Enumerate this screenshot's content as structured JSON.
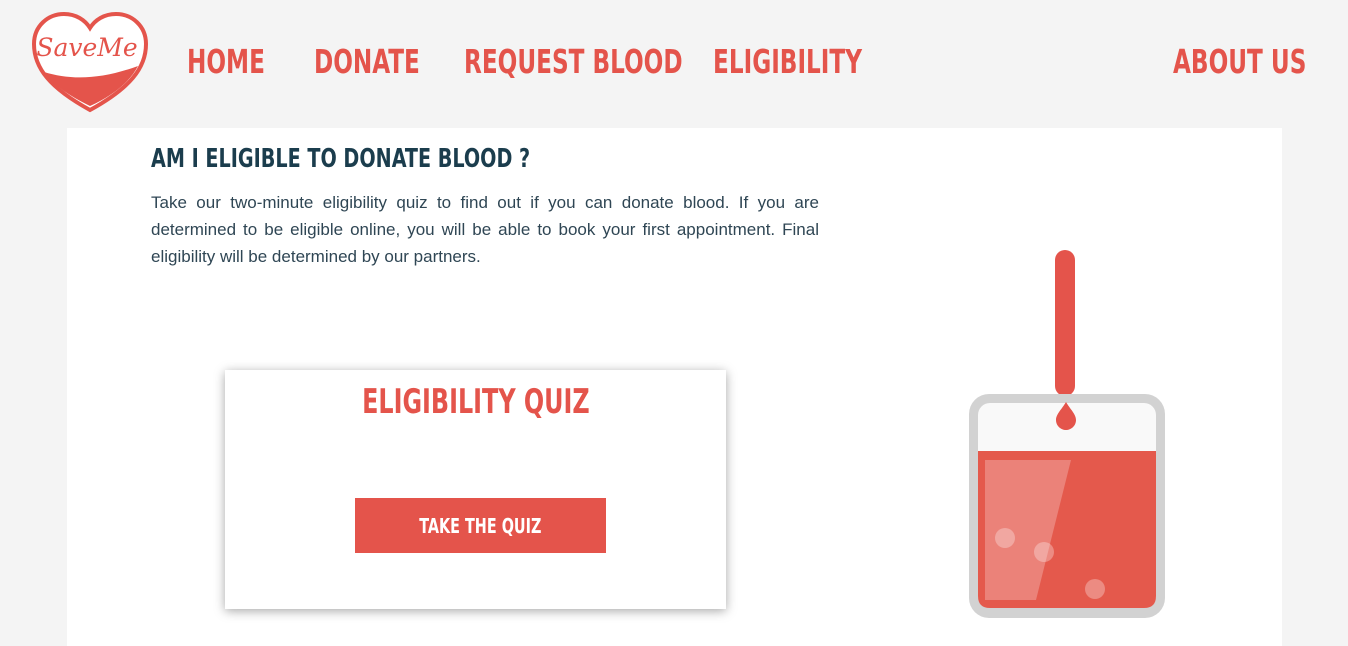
{
  "brand": {
    "logo_text": "SaveMe",
    "primary_color": "#e4544b",
    "heading_color": "#1b3d4d"
  },
  "nav": {
    "items": [
      {
        "label": "HOME"
      },
      {
        "label": "DONATE"
      },
      {
        "label": "REQUEST BLOOD"
      },
      {
        "label": "ELIGIBILITY"
      },
      {
        "label": "ABOUT US"
      }
    ]
  },
  "main": {
    "title": "AM I ELIGIBLE TO DONATE BLOOD ?",
    "intro": "Take our two-minute eligibility quiz to find out if you can donate blood. If you are determined to be eligible online, you will be able to book your first appointment. Final eligibility will be determined by our partners."
  },
  "quiz": {
    "title": "ELIGIBILITY QUIZ",
    "button_label": "TAKE THE QUIZ"
  },
  "illustration": {
    "icon": "blood-bag-icon"
  }
}
